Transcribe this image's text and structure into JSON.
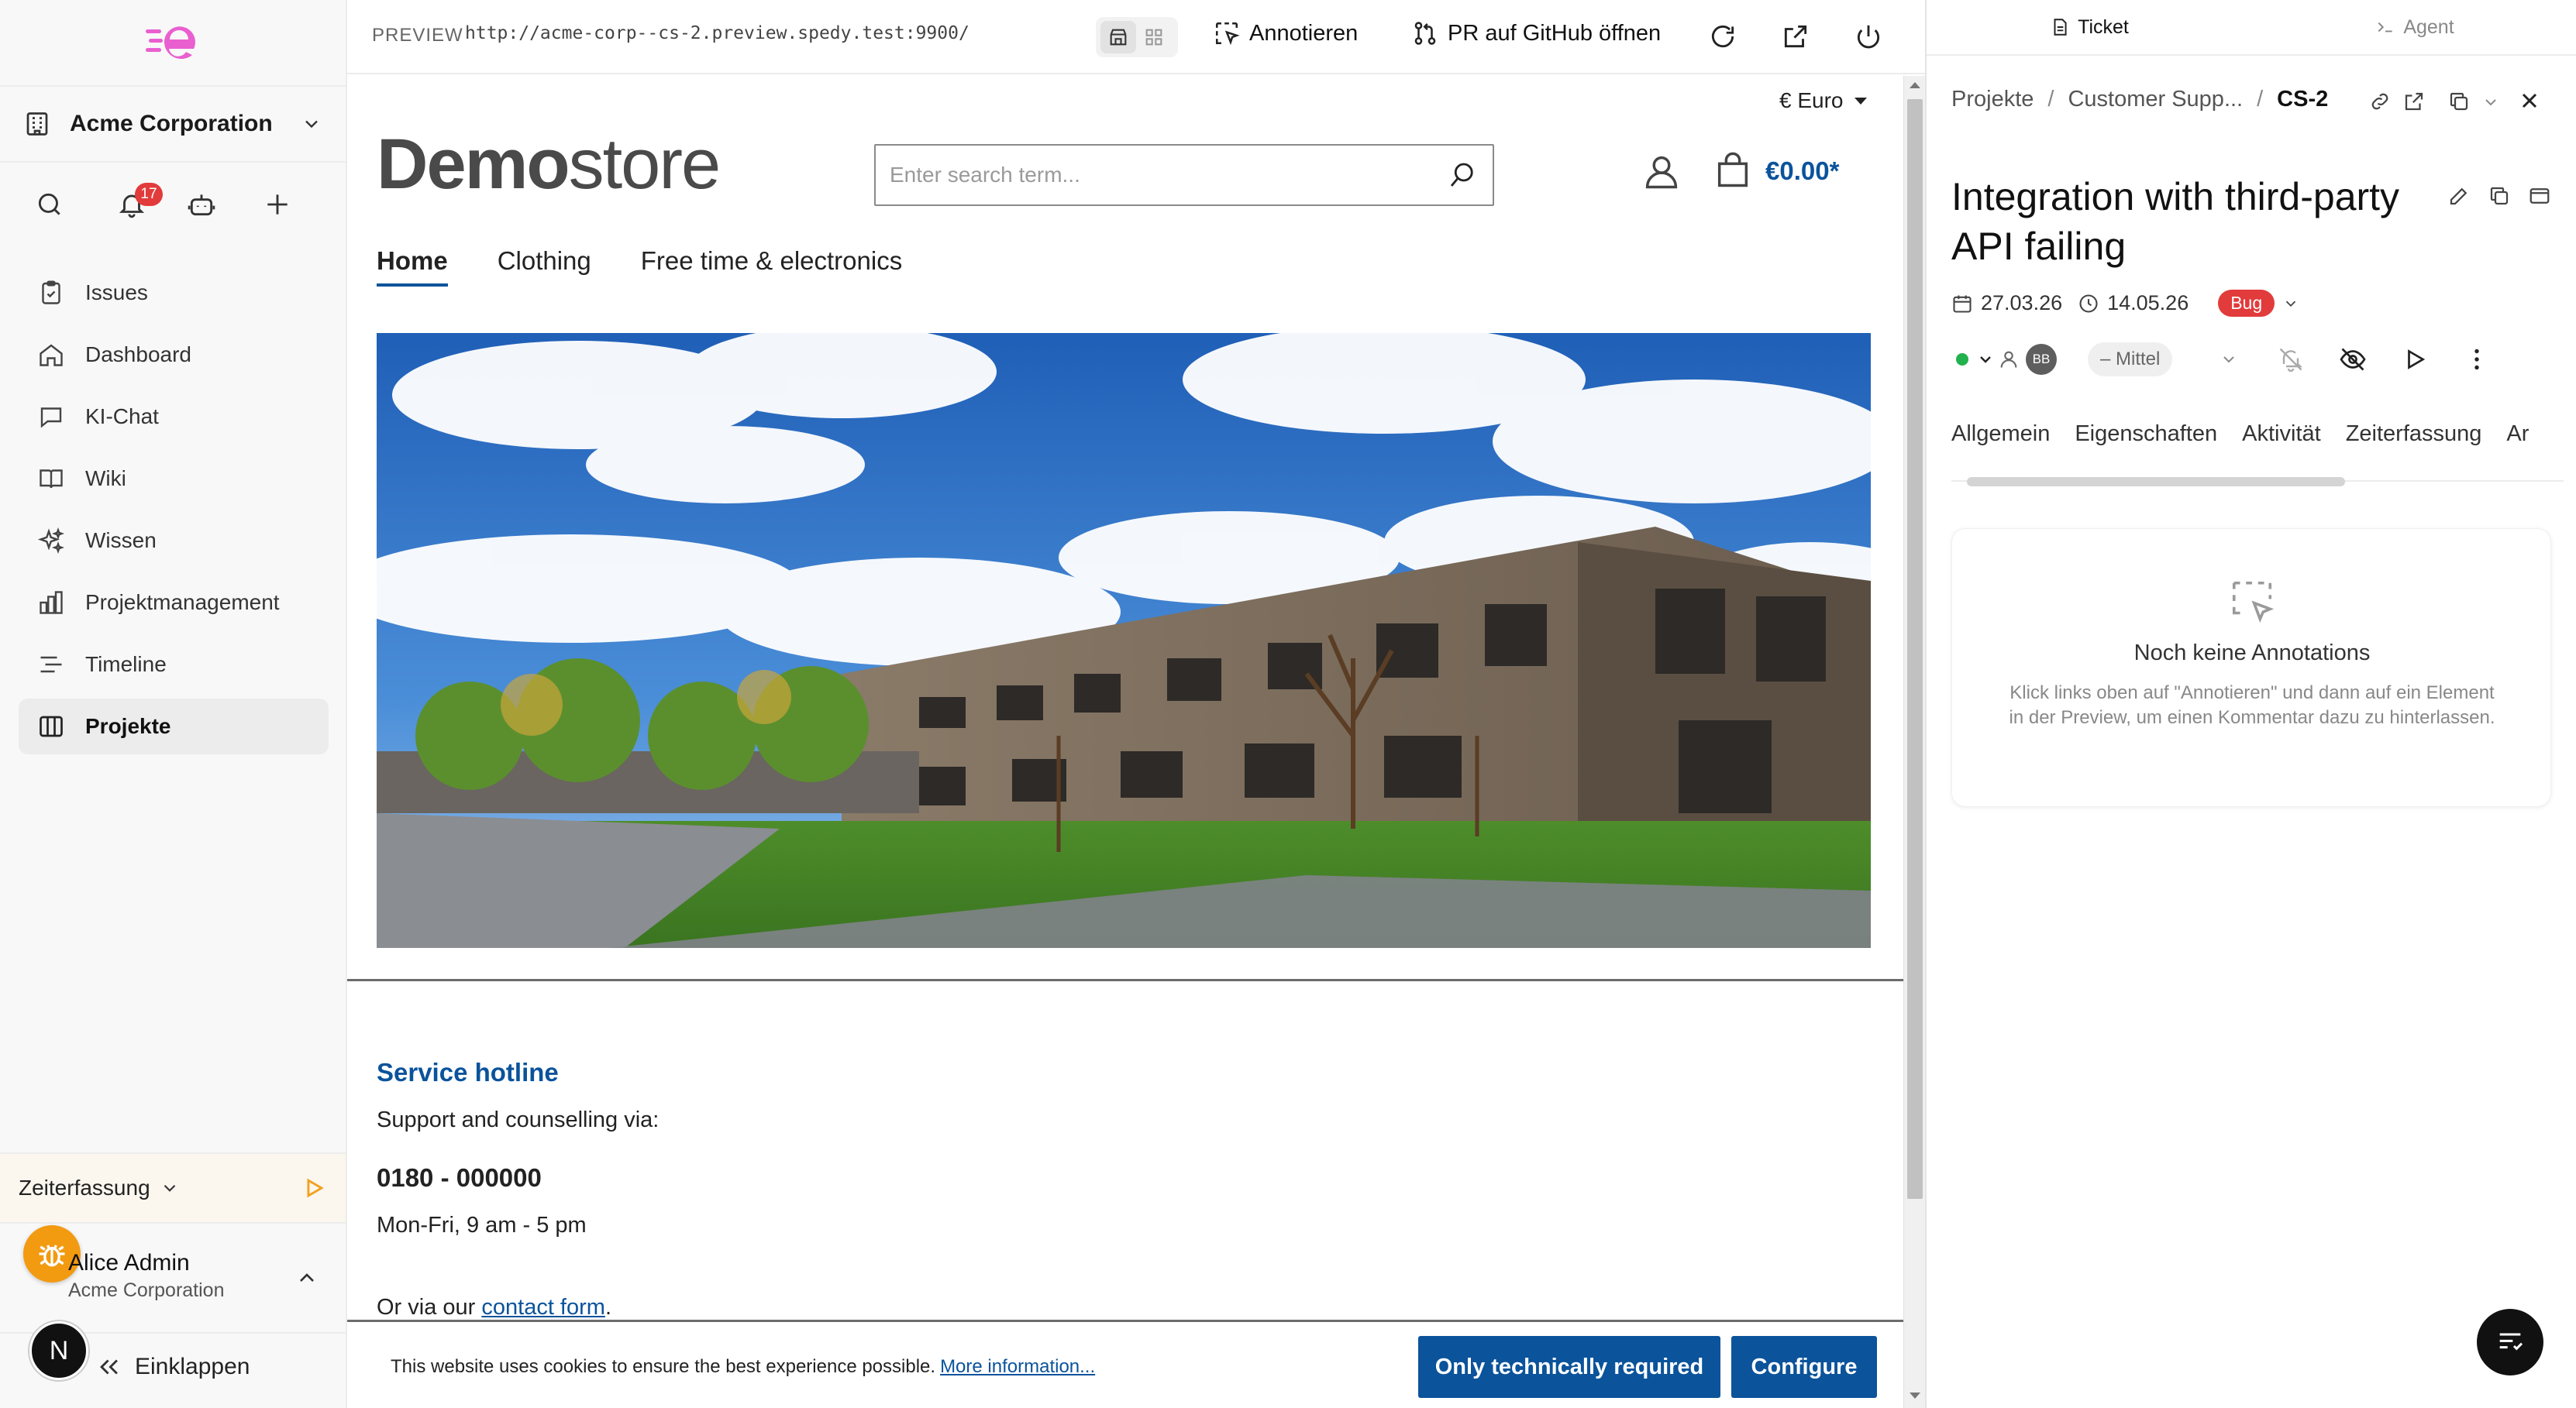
{
  "sidebar": {
    "org_name": "Acme Corporation",
    "notification_count": "17",
    "nav": [
      {
        "label": "Issues",
        "icon": "clipboard-icon"
      },
      {
        "label": "Dashboard",
        "icon": "home-icon"
      },
      {
        "label": "KI-Chat",
        "icon": "chat-icon"
      },
      {
        "label": "Wiki",
        "icon": "book-icon"
      },
      {
        "label": "Wissen",
        "icon": "sparkles-icon"
      },
      {
        "label": "Projektmanagement",
        "icon": "bar-chart-icon"
      },
      {
        "label": "Timeline",
        "icon": "timeline-icon"
      },
      {
        "label": "Projekte",
        "icon": "columns-icon"
      }
    ],
    "active_nav": "Projekte",
    "time_tracking_label": "Zeiterfassung",
    "user_name": "Alice Admin",
    "user_org": "Acme Corporation",
    "avatar_initial": "N",
    "collapse_label": "Einklappen"
  },
  "toolbar": {
    "preview_label": "PREVIEW",
    "url": "http://acme-corp--cs-2.preview.spedy.test:9900/",
    "annotate_label": "Annotieren",
    "pr_label": "PR auf GitHub öffnen"
  },
  "shop": {
    "currency": "€ Euro",
    "brand_bold": "Demo",
    "brand_light": "store",
    "search_placeholder": "Enter search term...",
    "cart_total": "€0.00*",
    "nav": [
      "Home",
      "Clothing",
      "Free time & electronics"
    ],
    "hotline_title": "Service hotline",
    "hotline_sub": "Support and counselling via:",
    "hotline_number": "0180 - 000000",
    "hotline_hours": "Mon-Fri, 9 am - 5 pm",
    "contact_prefix": "Or via our ",
    "contact_link": "contact form",
    "contact_suffix": ".",
    "cookie_text": "This website uses cookies to ensure the best experience possible.",
    "cookie_link": "More information...",
    "cookie_btn_required": "Only technically required",
    "cookie_btn_configure": "Configure",
    "accent_color": "#0b539b"
  },
  "panel": {
    "tabs": [
      "Ticket",
      "Agent"
    ],
    "breadcrumb": [
      "Projekte",
      "Customer Supp...",
      "CS-2"
    ],
    "title": "Integration with third-party API failing",
    "start_date": "27.03.26",
    "due_date": "14.05.26",
    "type_badge": "Bug",
    "assignee_initials": "BB",
    "priority": "– Mittel",
    "detail_tabs": [
      "Allgemein",
      "Eigenschaften",
      "Aktivität",
      "Zeiterfassung",
      "Ar"
    ],
    "annotations_empty_title": "Noch keine Annotations",
    "annotations_empty_desc": "Klick links oben auf \"Annotieren\" und dann auf ein Element in der Preview, um einen Kommentar dazu zu hinterlassen.",
    "status_color": "#22b14c",
    "bug_color": "#e23b3b"
  }
}
